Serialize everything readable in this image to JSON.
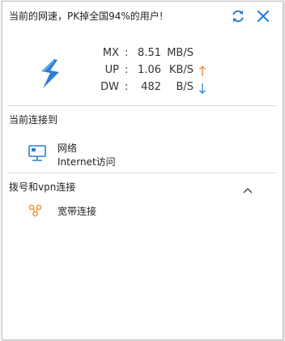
{
  "header": {
    "title": "当前的网速，PK掉全国94%的用户!"
  },
  "icons": {
    "refresh": "refresh-icon",
    "close": "close-icon",
    "logo": "lightning-icon",
    "network": "network-icon",
    "broadband": "broadband-icon",
    "collapse": "chevron-up-icon"
  },
  "speed": {
    "rows": [
      {
        "label": "MX",
        "value": "8.51",
        "unit": "MB/S",
        "arrow": ""
      },
      {
        "label": "UP",
        "value": "1.06",
        "unit": "KB/S",
        "arrow": "up"
      },
      {
        "label": "DW",
        "value": "482",
        "unit": "B/S",
        "arrow": "down"
      }
    ]
  },
  "connected": {
    "header": "当前连接到",
    "network_name": "网络",
    "network_status": "Internet访问"
  },
  "dialup": {
    "header": "拨号和vpn连接",
    "items": [
      {
        "label": "宽带连接"
      }
    ]
  },
  "colors": {
    "accent_blue": "#2a7fd4",
    "up_arrow": "#f08a4b",
    "down_arrow": "#3c8fd8",
    "broadband_icon": "#e8962e"
  }
}
